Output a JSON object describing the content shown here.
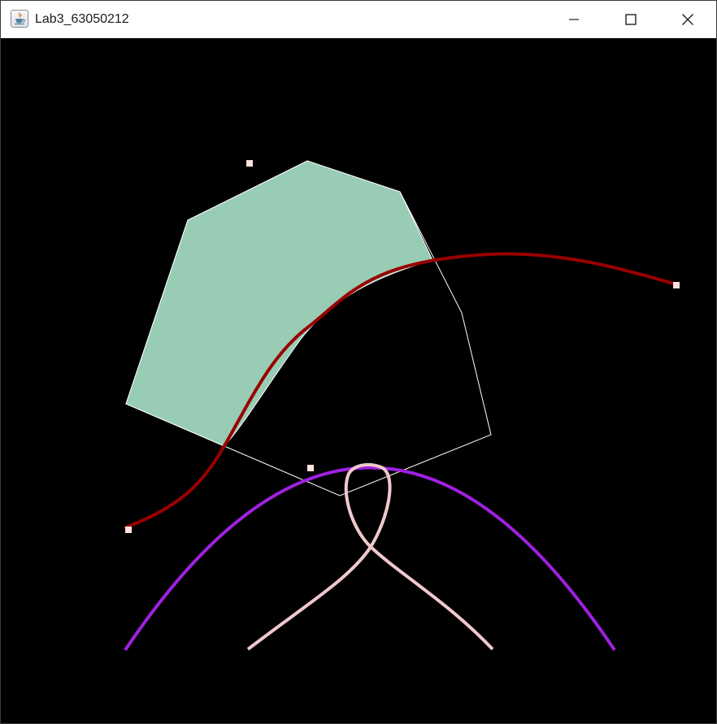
{
  "window": {
    "title": "Lab3_63050212",
    "icon": "java-cup-icon",
    "controls": [
      "minimize-icon",
      "maximize-icon",
      "close-icon"
    ]
  },
  "canvas": {
    "background": "#000000",
    "polygon_fill": "#98CCB4",
    "polygon_outline": "#FFFFFF",
    "bezier_curve_color": "#990000",
    "arc_color": "#A020E0",
    "loop_curve_color": "#F0C8CC",
    "control_point_color": "#FBE3DD"
  }
}
